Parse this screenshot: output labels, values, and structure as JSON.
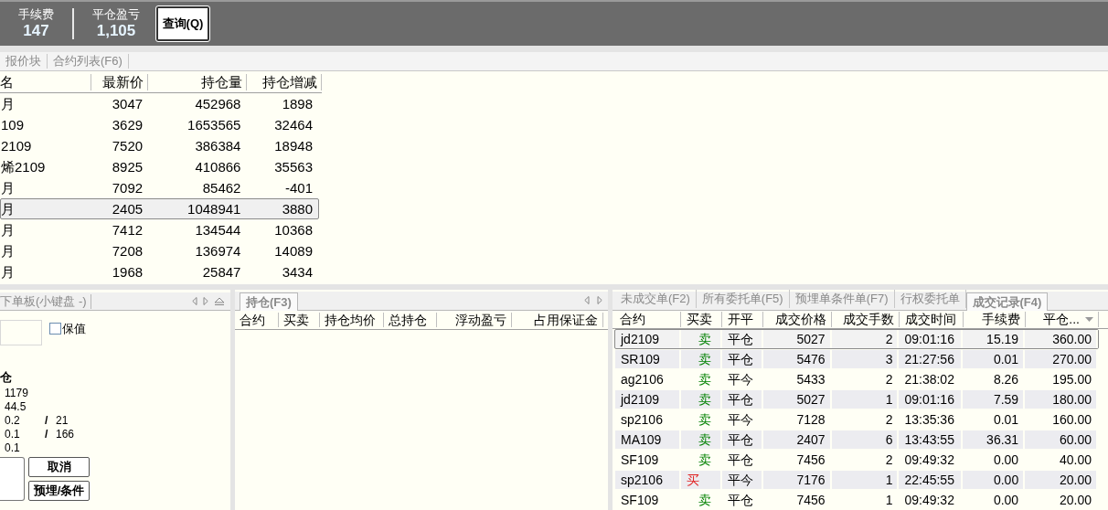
{
  "stats": [
    {
      "label": "手续费",
      "value": "147"
    },
    {
      "label": "平仓盈亏",
      "value": "1,105"
    }
  ],
  "query_button": "查询(Q)",
  "quote_tabs": [
    {
      "label": "报价块",
      "selected": false
    },
    {
      "label": "合约列表(F6)",
      "selected": false
    }
  ],
  "quote_table": {
    "columns": [
      "名",
      "最新价",
      "持仓量",
      "持仓增减"
    ],
    "rows": [
      {
        "cells": [
          "月",
          "3047",
          "452968",
          "1898"
        ],
        "selected": false
      },
      {
        "cells": [
          "109",
          "3629",
          "1653565",
          "32464"
        ],
        "selected": false
      },
      {
        "cells": [
          "2109",
          "7520",
          "386384",
          "18948"
        ],
        "selected": false
      },
      {
        "cells": [
          "烯2109",
          "8925",
          "410866",
          "35563"
        ],
        "selected": false
      },
      {
        "cells": [
          "月",
          "7092",
          "85462",
          "-401"
        ],
        "selected": false
      },
      {
        "cells": [
          "月",
          "2405",
          "1048941",
          "3880"
        ],
        "selected": true
      },
      {
        "cells": [
          "月",
          "7412",
          "134544",
          "10368"
        ],
        "selected": false
      },
      {
        "cells": [
          "月",
          "7208",
          "136974",
          "14089"
        ],
        "selected": false
      },
      {
        "cells": [
          "月",
          "1968",
          "25847",
          "3434"
        ],
        "selected": false
      }
    ]
  },
  "order_panel": {
    "tab": "下单板(小键盘 -)",
    "hedge_checkbox": {
      "label": "保值",
      "checked": false
    },
    "heading": "仓",
    "lines": [
      [
        "1179"
      ],
      [
        "44.5"
      ],
      [
        "0.2",
        "21"
      ],
      [
        "0.1",
        "166"
      ],
      [
        "0.1"
      ]
    ],
    "separator": "/",
    "buttons": [
      "取消",
      "预埋/条件"
    ]
  },
  "position_panel": {
    "tab": "持仓(F3)",
    "columns": [
      "合约",
      "买卖",
      "持仓均价",
      "总持仓",
      "浮动盈亏",
      "占用保证金"
    ]
  },
  "trade_panel": {
    "tabs": [
      {
        "label": "未成交单(F2)",
        "selected": false
      },
      {
        "label": "所有委托单(F5)",
        "selected": false
      },
      {
        "label": "预埋单条件单(F7)",
        "selected": false
      },
      {
        "label": "行权委托单",
        "selected": false
      },
      {
        "label": "成交记录(F4)",
        "selected": true
      }
    ],
    "columns": [
      "合约",
      "买卖",
      "开平",
      "成交价格",
      "成交手数",
      "成交时间",
      "手续费",
      "平仓..."
    ],
    "rows": [
      {
        "cells": [
          "jd2109",
          "卖",
          "平仓",
          "5027",
          "2",
          "09:01:16",
          "15.19",
          "360.00"
        ],
        "color": "#008000",
        "selected": true
      },
      {
        "cells": [
          "SR109",
          "卖",
          "平仓",
          "5476",
          "3",
          "21:27:56",
          "0.01",
          "270.00"
        ],
        "color": "#008000",
        "selected": false
      },
      {
        "cells": [
          "ag2106",
          "卖",
          "平今",
          "5433",
          "2",
          "21:38:02",
          "8.26",
          "195.00"
        ],
        "color": "#008000",
        "selected": false
      },
      {
        "cells": [
          "jd2109",
          "卖",
          "平仓",
          "5027",
          "1",
          "09:01:16",
          "7.59",
          "180.00"
        ],
        "color": "#008000",
        "selected": false
      },
      {
        "cells": [
          "sp2106",
          "卖",
          "平今",
          "7128",
          "2",
          "13:35:36",
          "0.01",
          "160.00"
        ],
        "color": "#008000",
        "selected": false
      },
      {
        "cells": [
          "MA109",
          "卖",
          "平仓",
          "2407",
          "6",
          "13:43:55",
          "36.31",
          "60.00"
        ],
        "color": "#008000",
        "selected": false
      },
      {
        "cells": [
          "SF109",
          "卖",
          "平仓",
          "7456",
          "2",
          "09:49:32",
          "0.00",
          "40.00"
        ],
        "color": "#008000",
        "selected": false
      },
      {
        "cells": [
          "sp2106",
          "买",
          "平今",
          "7176",
          "1",
          "22:45:55",
          "0.00",
          "20.00"
        ],
        "color": "#e02020",
        "selected": false
      },
      {
        "cells": [
          "SF109",
          "卖",
          "平仓",
          "7456",
          "1",
          "09:49:32",
          "0.00",
          "20.00"
        ],
        "color": "#008000",
        "selected": false
      }
    ]
  }
}
